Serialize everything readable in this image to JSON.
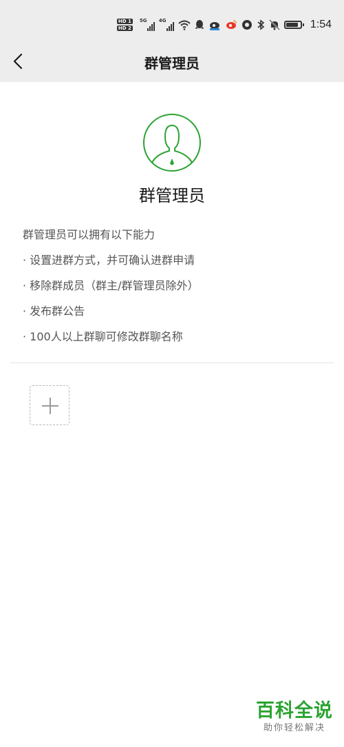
{
  "status_bar": {
    "sim1": "HD 1",
    "sim2": "HD 2",
    "net1": "5G",
    "net2": "4G",
    "time": "1:54",
    "battery_level": 0.85,
    "icons": [
      "wifi-icon",
      "qq-icon",
      "weibo-icon",
      "weibo-red-icon",
      "chrome-icon",
      "bluetooth-icon",
      "mute-icon",
      "battery-icon"
    ]
  },
  "header": {
    "title": "群管理员",
    "back_icon": "chevron-left-icon"
  },
  "profile": {
    "avatar_icon": "admin-person-icon",
    "title": "群管理员",
    "accent_color": "#2ba332"
  },
  "abilities": {
    "intro": "群管理员可以拥有以下能力",
    "items": [
      "· 设置进群方式，并可确认进群申请",
      "· 移除群成员（群主/群管理员除外）",
      "· 发布群公告",
      "· 100人以上群聊可修改群聊名称"
    ]
  },
  "add_admin": {
    "icon": "plus-icon"
  },
  "watermark": {
    "main": "百科全说",
    "sub": "助你轻松解决"
  }
}
